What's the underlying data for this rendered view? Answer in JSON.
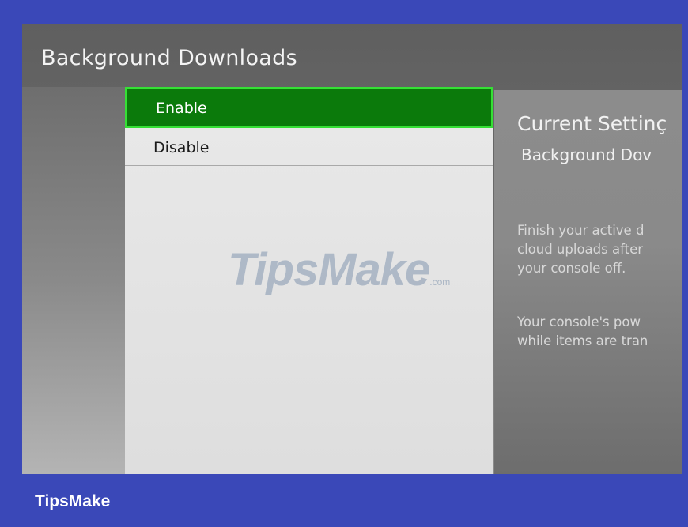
{
  "screen": {
    "title": "Background Downloads"
  },
  "options": [
    {
      "label": "Enable",
      "selected": true
    },
    {
      "label": "Disable",
      "selected": false
    }
  ],
  "info": {
    "heading": "Current Settinç",
    "subheading": "Background Dov",
    "paragraph1": [
      "Finish your active d",
      "cloud uploads after",
      "your console off."
    ],
    "paragraph2": [
      "Your console's pow",
      "while items are tran"
    ]
  },
  "watermark": {
    "text": "TipsMake",
    "suffix": ".com"
  },
  "brand": {
    "label": "TipsMake"
  },
  "colors": {
    "frame": "#3a48b8",
    "selected_fill": "#0b7a0b",
    "selected_border": "#35e035"
  }
}
